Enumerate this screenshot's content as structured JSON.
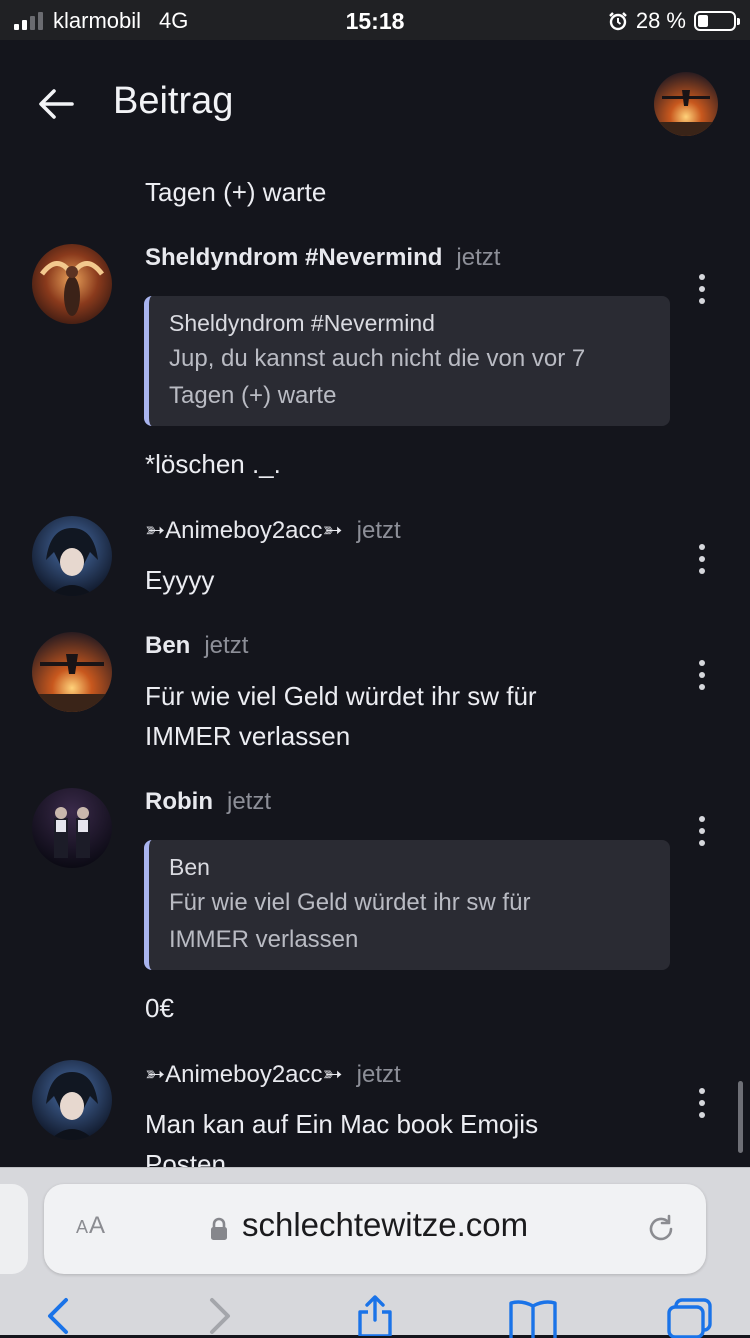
{
  "status_bar": {
    "carrier": "klarmobil",
    "network": "4G",
    "time": "15:18",
    "battery_percent": "28 %",
    "battery_level": 0.28
  },
  "header": {
    "title": "Beitrag"
  },
  "feed": {
    "cutoff_text": "Tagen (+) warte",
    "posts": [
      {
        "author": "Sheldyndrom #Nevermind",
        "time": "jetzt",
        "quote": {
          "author": "Sheldyndrom #Nevermind",
          "line1": "Jup, du kannst auch nicht die von vor 7",
          "line2": "Tagen (+) warte"
        },
        "text": "*löschen ._."
      },
      {
        "author": "➳Animeboy2acc➳",
        "time": "jetzt",
        "text": "Eyyyy"
      },
      {
        "author": "Ben",
        "time": "jetzt",
        "line1": "Für wie viel Geld würdet ihr sw für",
        "line2": "IMMER verlassen"
      },
      {
        "author": "Robin",
        "time": "jetzt",
        "quote": {
          "author": "Ben",
          "line1": "Für wie viel Geld würdet ihr sw für",
          "line2": "IMMER verlassen"
        },
        "text": "0€"
      },
      {
        "author": "➳Animeboy2acc➳",
        "time": "jetzt",
        "line1": "Man kan auf Ein Mac book Emojis",
        "line2": "Posten"
      }
    ]
  },
  "browser": {
    "text_size_label_small": "A",
    "text_size_label_large": "A",
    "url": "schlechtewitze.com"
  },
  "colors": {
    "background": "#14151c",
    "quote_bar": "#a9b4ef",
    "quote_bg": "#2a2b33",
    "muted": "#8d8f98",
    "safari_blue": "#1a73e8"
  }
}
